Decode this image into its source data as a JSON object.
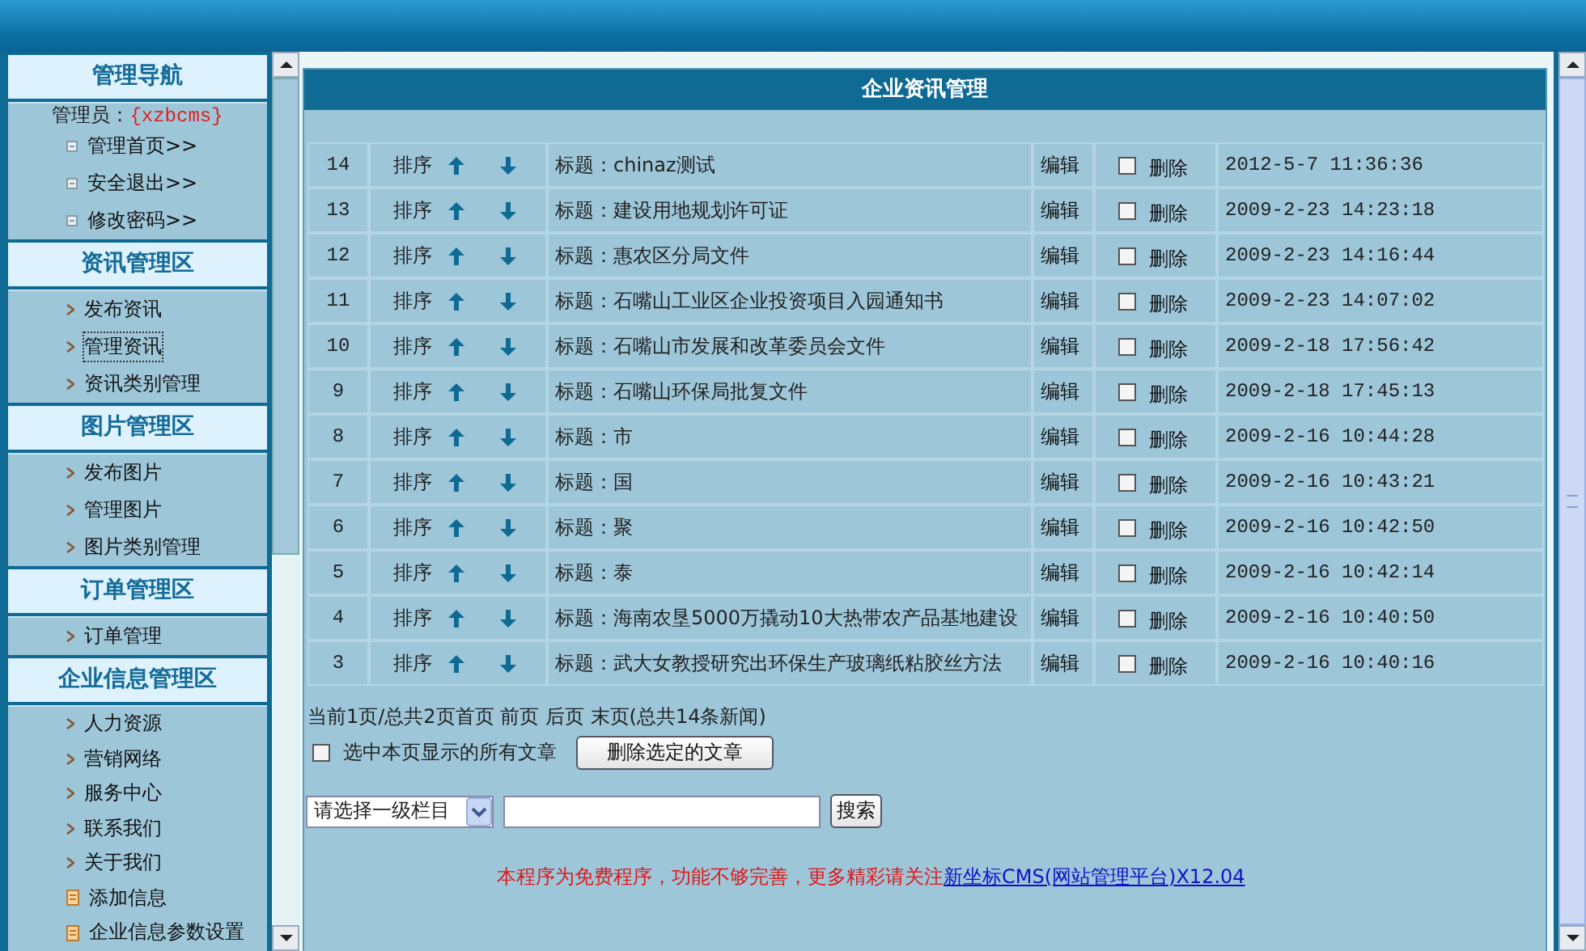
{
  "nav": {
    "sections": [
      {
        "title": "管理导航",
        "admin_label": "管理员：",
        "admin_name": "{xzbcms}",
        "items": [
          {
            "label": "管理首页>>",
            "kind": "square",
            "selected": false
          },
          {
            "label": "安全退出>>",
            "kind": "square",
            "selected": false
          },
          {
            "label": "修改密码>>",
            "kind": "square",
            "selected": false
          }
        ]
      },
      {
        "title": "资讯管理区",
        "items": [
          {
            "label": "发布资讯",
            "kind": "chevron",
            "selected": false
          },
          {
            "label": "管理资讯",
            "kind": "chevron",
            "selected": true
          },
          {
            "label": "资讯类别管理",
            "kind": "chevron",
            "selected": false
          }
        ]
      },
      {
        "title": "图片管理区",
        "items": [
          {
            "label": "发布图片",
            "kind": "chevron",
            "selected": false
          },
          {
            "label": "管理图片",
            "kind": "chevron",
            "selected": false
          },
          {
            "label": "图片类别管理",
            "kind": "chevron",
            "selected": false
          }
        ]
      },
      {
        "title": "订单管理区",
        "items": [
          {
            "label": "订单管理",
            "kind": "chevron",
            "selected": false
          }
        ]
      },
      {
        "title": "企业信息管理区",
        "items": [
          {
            "label": "人力资源",
            "kind": "chevron",
            "selected": false
          },
          {
            "label": "营销网络",
            "kind": "chevron",
            "selected": false
          },
          {
            "label": "服务中心",
            "kind": "chevron",
            "selected": false
          },
          {
            "label": "联系我们",
            "kind": "chevron",
            "selected": false
          },
          {
            "label": "关于我们",
            "kind": "chevron",
            "selected": false
          },
          {
            "label": "添加信息",
            "kind": "doc",
            "selected": false
          },
          {
            "label": "企业信息参数设置",
            "kind": "doc",
            "selected": false
          }
        ]
      }
    ]
  },
  "panel": {
    "title": "企业资讯管理",
    "rows": [
      {
        "id": "14",
        "sort": "排序",
        "title": "标题：chinaz测试",
        "edit": "编辑",
        "checked": false,
        "delete": "删除",
        "date": "2012-5-7 11:36:36"
      },
      {
        "id": "13",
        "sort": "排序",
        "title": "标题：建设用地规划许可证",
        "edit": "编辑",
        "checked": false,
        "delete": "删除",
        "date": "2009-2-23 14:23:18"
      },
      {
        "id": "12",
        "sort": "排序",
        "title": "标题：惠农区分局文件",
        "edit": "编辑",
        "checked": false,
        "delete": "删除",
        "date": "2009-2-23 14:16:44"
      },
      {
        "id": "11",
        "sort": "排序",
        "title": "标题：石嘴山工业区企业投资项目入园通知书",
        "edit": "编辑",
        "checked": false,
        "delete": "删除",
        "date": "2009-2-23 14:07:02"
      },
      {
        "id": "10",
        "sort": "排序",
        "title": "标题：石嘴山市发展和改革委员会文件",
        "edit": "编辑",
        "checked": false,
        "delete": "删除",
        "date": "2009-2-18 17:56:42"
      },
      {
        "id": "9",
        "sort": "排序",
        "title": "标题：石嘴山环保局批复文件",
        "edit": "编辑",
        "checked": false,
        "delete": "删除",
        "date": "2009-2-18 17:45:13"
      },
      {
        "id": "8",
        "sort": "排序",
        "title": "标题：市",
        "edit": "编辑",
        "checked": false,
        "delete": "删除",
        "date": "2009-2-16 10:44:28"
      },
      {
        "id": "7",
        "sort": "排序",
        "title": "标题：国",
        "edit": "编辑",
        "checked": false,
        "delete": "删除",
        "date": "2009-2-16 10:43:21"
      },
      {
        "id": "6",
        "sort": "排序",
        "title": "标题：聚",
        "edit": "编辑",
        "checked": false,
        "delete": "删除",
        "date": "2009-2-16 10:42:50"
      },
      {
        "id": "5",
        "sort": "排序",
        "title": "标题：泰",
        "edit": "编辑",
        "checked": false,
        "delete": "删除",
        "date": "2009-2-16 10:42:14"
      },
      {
        "id": "4",
        "sort": "排序",
        "title": "标题：海南农垦5000万撬动10大热带农产品基地建设",
        "edit": "编辑",
        "checked": false,
        "delete": "删除",
        "date": "2009-2-16 10:40:50"
      },
      {
        "id": "3",
        "sort": "排序",
        "title": "标题：武大女教授研究出环保生产玻璃纸粘胶丝方法",
        "edit": "编辑",
        "checked": false,
        "delete": "删除",
        "date": "2009-2-16 10:40:16"
      }
    ],
    "pagination": "当前1页/总共2页首页 前页 后页 末页(总共14条新闻)",
    "select_all": {
      "label": "选中本页显示的所有文章",
      "checked": false
    },
    "delete_button": "删除选定的文章",
    "category_select": "请选择一级栏目",
    "search_button": "搜索",
    "footer": {
      "notice": "本程序为免费程序，功能不够完善，更多精彩请关注",
      "link": "新坐标CMS(网站管理平台)X12.04"
    }
  }
}
